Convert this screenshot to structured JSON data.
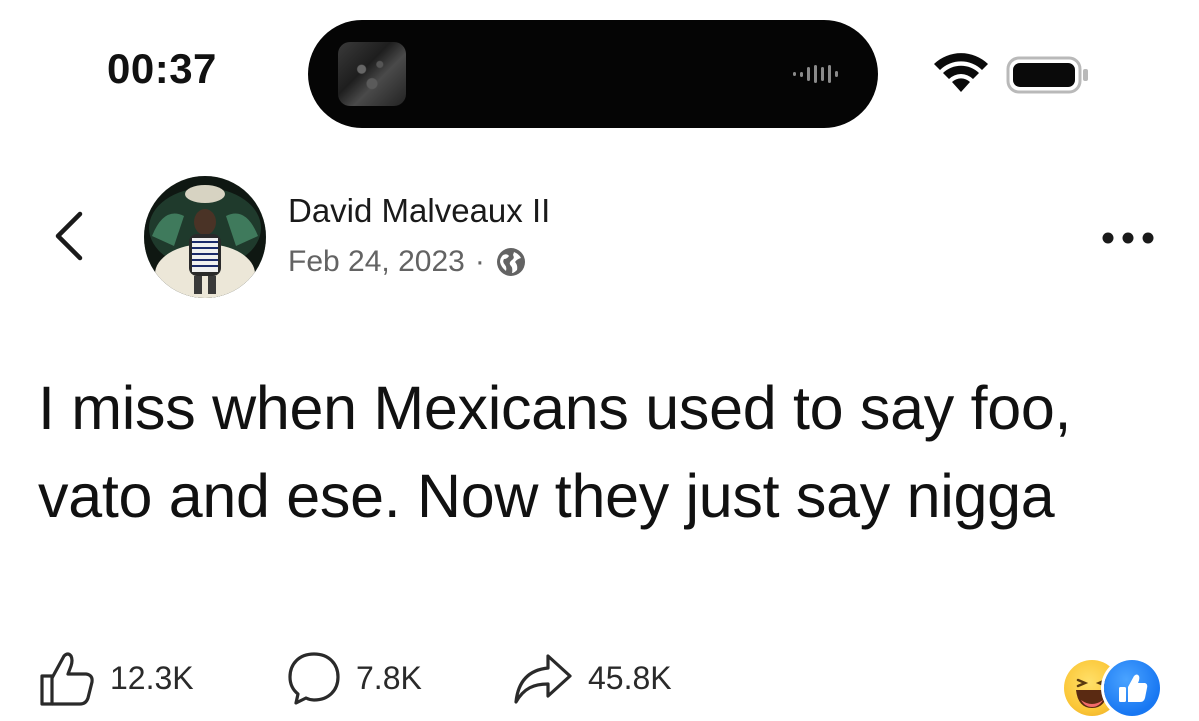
{
  "status_bar": {
    "time": "00:37",
    "icons": [
      "wifi-icon",
      "battery-icon"
    ]
  },
  "post": {
    "author": "David Malveaux II",
    "date": "Feb 24, 2023",
    "separator": "·",
    "privacy_icon": "globe-icon",
    "text": "I miss when Mexicans used to say foo, vato and ese. Now they just say nigga"
  },
  "actions": {
    "like_count": "12.3K",
    "comment_count": "7.8K",
    "share_count": "45.8K"
  },
  "reactions": [
    "haha",
    "like"
  ],
  "colors": {
    "text": "#111111",
    "meta": "#636363",
    "facebook_blue": "#1877f2",
    "haha_yellow": "#fbc738"
  }
}
